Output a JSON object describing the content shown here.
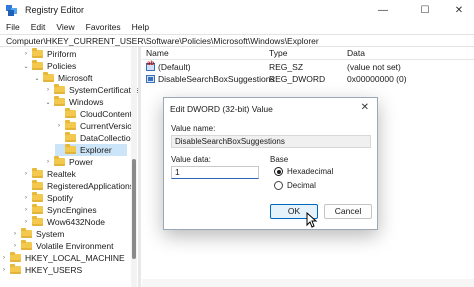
{
  "window": {
    "title": "Registry Editor",
    "minimize_glyph": "—",
    "maximize_glyph": "☐",
    "close_glyph": "✕"
  },
  "menu": [
    "File",
    "Edit",
    "View",
    "Favorites",
    "Help"
  ],
  "address": "Computer\\HKEY_CURRENT_USER\\Software\\Policies\\Microsoft\\Windows\\Explorer",
  "tree": {
    "items": [
      {
        "label": "Piriform",
        "expander": "›"
      },
      {
        "label": "Policies",
        "expander": "⌄"
      },
      {
        "label": "Microsoft",
        "expander": "⌄"
      },
      {
        "label": "SystemCertificates",
        "expander": "›"
      },
      {
        "label": "Windows",
        "expander": "⌄"
      },
      {
        "label": "CloudContent",
        "expander": ""
      },
      {
        "label": "CurrentVersion",
        "expander": "›"
      },
      {
        "label": "DataCollection",
        "expander": ""
      },
      {
        "label": "Explorer",
        "expander": ""
      },
      {
        "label": "Power",
        "expander": "›"
      },
      {
        "label": "Realtek",
        "expander": "›"
      },
      {
        "label": "RegisteredApplications",
        "expander": ""
      },
      {
        "label": "Spotify",
        "expander": "›"
      },
      {
        "label": "SyncEngines",
        "expander": "›"
      },
      {
        "label": "Wow6432Node",
        "expander": "›"
      },
      {
        "label": "System",
        "expander": "›"
      },
      {
        "label": "Volatile Environment",
        "expander": "›"
      },
      {
        "label": "HKEY_LOCAL_MACHINE",
        "expander": "›"
      },
      {
        "label": "HKEY_USERS",
        "expander": "›"
      }
    ]
  },
  "list": {
    "columns": [
      "Name",
      "Type",
      "Data"
    ],
    "rows": [
      {
        "name": "(Default)",
        "type": "REG_SZ",
        "data": "(value not set)",
        "icon": "string-value-icon"
      },
      {
        "name": "DisableSearchBoxSuggestions",
        "type": "REG_DWORD",
        "data": "0x00000000 (0)",
        "icon": "dword-value-icon"
      }
    ]
  },
  "dialog": {
    "title": "Edit DWORD (32-bit) Value",
    "value_name_label": "Value name:",
    "value_name": "DisableSearchBoxSuggestions",
    "value_data_label": "Value data:",
    "value_data": "1",
    "base_label": "Base",
    "base_options": [
      "Hexadecimal",
      "Decimal"
    ],
    "base_selected": "Hexadecimal",
    "ok_label": "OK",
    "cancel_label": "Cancel",
    "close_glyph": "✕"
  },
  "colors": {
    "selection": "#cce4f7",
    "accent": "#0067c0",
    "folder": "#f2c94c"
  }
}
